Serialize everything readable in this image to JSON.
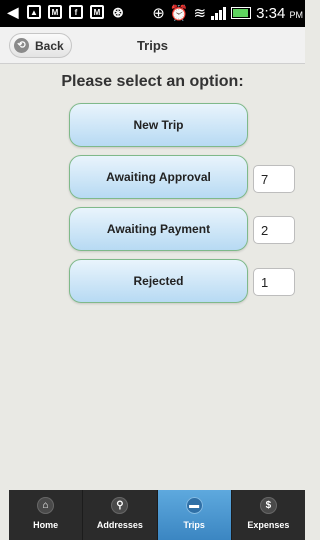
{
  "status_bar": {
    "time": "3:34",
    "ampm": "PM",
    "icons_left": [
      "back-arrow-icon",
      "picture-icon",
      "mail-icon",
      "facebook-icon",
      "gmail-icon",
      "sync-icon"
    ],
    "icons_right": [
      "vibrate-icon",
      "alarm-icon",
      "wifi-icon",
      "signal-icon",
      "battery-icon"
    ]
  },
  "header": {
    "back_label": "Back",
    "title": "Trips"
  },
  "main": {
    "prompt": "Please select an option:",
    "options": [
      {
        "label": "New Trip",
        "count": null
      },
      {
        "label": "Awaiting Approval",
        "count": "7"
      },
      {
        "label": "Awaiting Payment",
        "count": "2"
      },
      {
        "label": "Rejected",
        "count": "1"
      }
    ]
  },
  "tabbar": {
    "tabs": [
      {
        "label": "Home",
        "icon": "home-icon",
        "active": false
      },
      {
        "label": "Addresses",
        "icon": "map-pin-icon",
        "active": false
      },
      {
        "label": "Trips",
        "icon": "car-icon",
        "active": true
      },
      {
        "label": "Expenses",
        "icon": "dollar-icon",
        "active": false
      }
    ]
  },
  "colors": {
    "accent_tab": "#4a98d2",
    "option_button_top": "#e9f4fc",
    "option_button_bottom": "#b7daf3",
    "option_button_border": "#7fb98a"
  }
}
